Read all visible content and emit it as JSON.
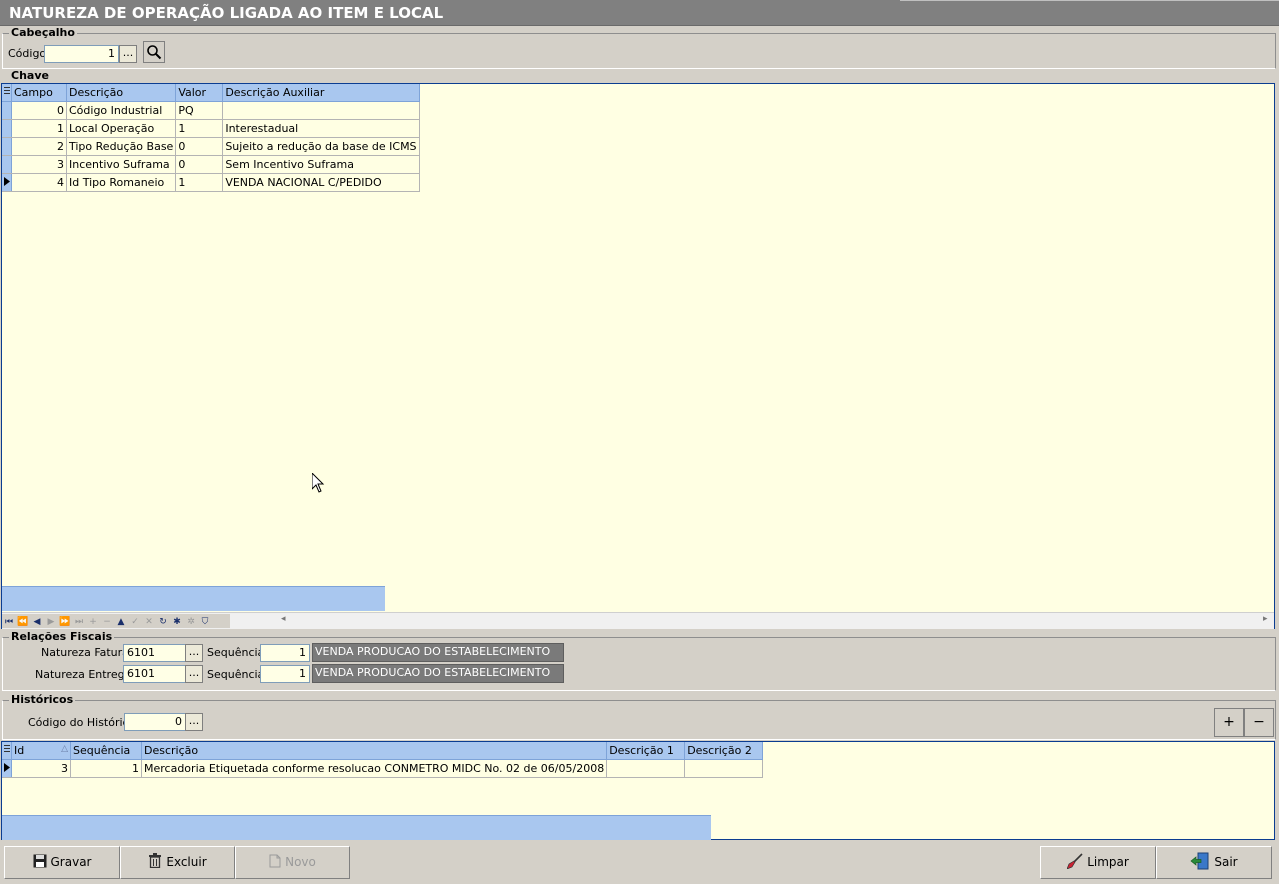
{
  "window": {
    "title": "NATUREZA DE OPERAÇÃO LIGADA AO ITEM E LOCAL"
  },
  "cabecalho": {
    "title": "Cabeçalho",
    "codigo_label": "Código",
    "codigo_value": "1",
    "lookup_label": "..."
  },
  "chave": {
    "title": "Chave",
    "columns": [
      "Campo",
      "Descrição",
      "Valor",
      "Descrição Auxiliar"
    ],
    "rows": [
      {
        "campo": "0",
        "descricao": "Código Industrial",
        "valor": "PQ",
        "aux": ""
      },
      {
        "campo": "1",
        "descricao": "Local Operação",
        "valor": "1",
        "aux": "Interestadual"
      },
      {
        "campo": "2",
        "descricao": "Tipo Redução Base",
        "valor": "0",
        "aux": "Sujeito a redução da base de ICMS"
      },
      {
        "campo": "3",
        "descricao": "Incentivo Suframa",
        "valor": "0",
        "aux": "Sem Incentivo Suframa"
      },
      {
        "campo": "4",
        "descricao": "Id Tipo Romaneio",
        "valor": "1",
        "aux": "VENDA NACIONAL C/PEDIDO"
      }
    ]
  },
  "relacoes": {
    "title": "Relações Fiscais",
    "fatura_label": "Natureza Fatura",
    "fatura_value": "6101",
    "entrega_label": "Natureza Entrega",
    "entrega_value": "6101",
    "sequencia_label": "Sequência",
    "fatura_seq": "1",
    "entrega_seq": "1",
    "fatura_desc": "VENDA PRODUCAO DO ESTABELECIMENTO",
    "entrega_desc": "VENDA PRODUCAO DO ESTABELECIMENTO",
    "lookup_label": "..."
  },
  "historicos": {
    "title": "Históricos",
    "codigo_label": "Código do Histórico",
    "codigo_value": "0",
    "lookup_label": "...",
    "add_label": "+",
    "remove_label": "−",
    "columns": [
      "Id",
      "Sequência",
      "Descrição",
      "Descrição 1",
      "Descrição 2"
    ],
    "rows": [
      {
        "id": "3",
        "sequencia": "1",
        "descricao": "Mercadoria Etiquetada conforme resolucao CONMETRO MIDC No. 02 de 06/05/2008",
        "d1": "",
        "d2": ""
      }
    ]
  },
  "buttons": {
    "gravar": "Gravar",
    "excluir": "Excluir",
    "novo": "Novo",
    "limpar": "Limpar",
    "sair": "Sair"
  },
  "icons": {
    "gravar": "floppy-disk-icon",
    "excluir": "trash-icon",
    "novo": "new-document-icon",
    "limpar": "broom-icon",
    "sair": "exit-door-icon",
    "search": "magnifier-icon"
  },
  "colors": {
    "grid_header": "#a9c7ef",
    "grid_background": "#ffffe3",
    "grid_border": "#0b3d91",
    "readonly_field": "#7a7a7a"
  }
}
